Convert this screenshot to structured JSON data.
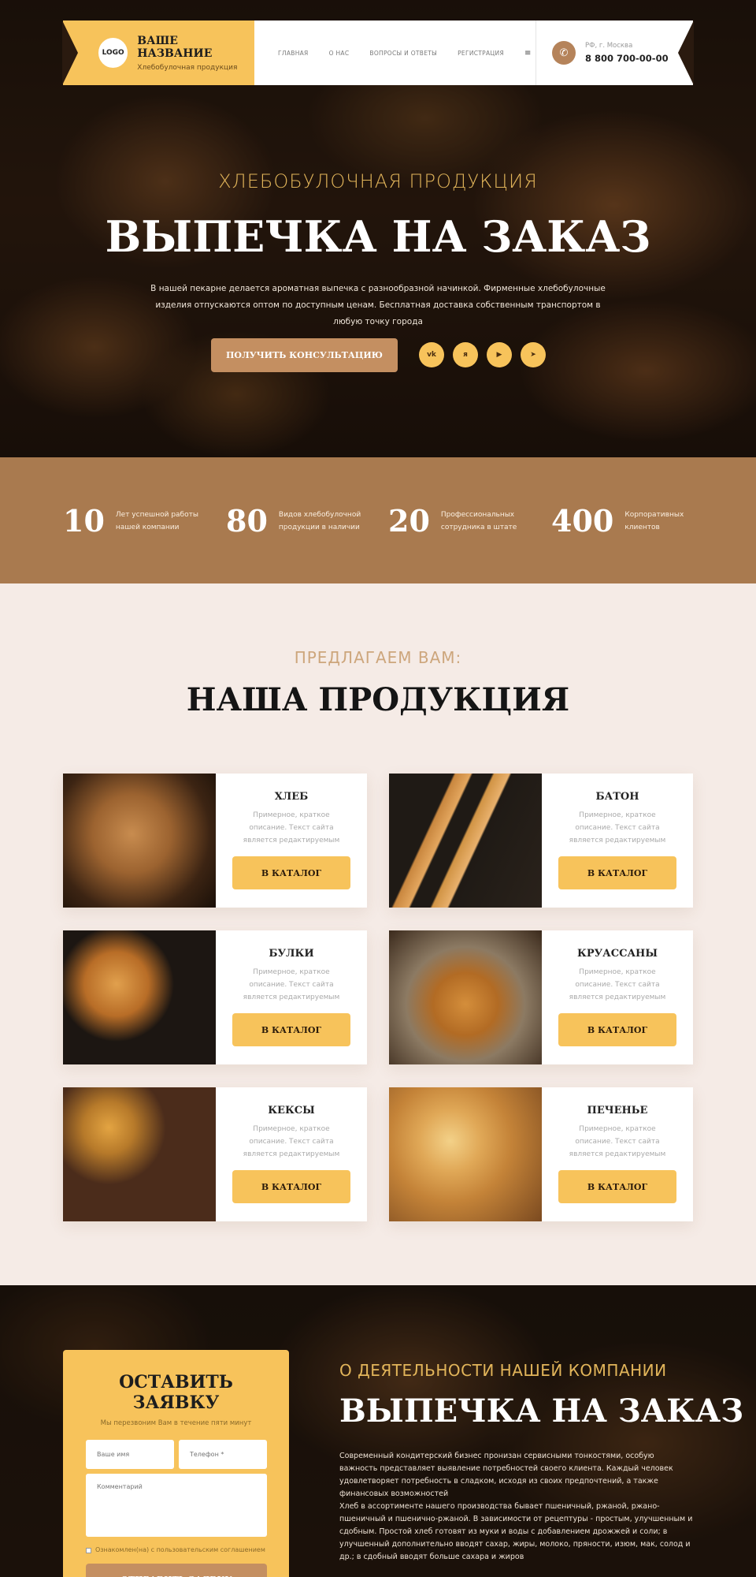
{
  "header": {
    "logo": "LOGO",
    "brand_name": "ВАШЕ НАЗВАНИЕ",
    "brand_sub": "Хлебобулочная продукция",
    "nav": [
      "ГЛАВНАЯ",
      "О НАС",
      "ВОПРОСЫ И ОТВЕТЫ",
      "РЕГИСТРАЦИЯ"
    ],
    "menu_icon": "≡",
    "city": "РФ, г. Москва",
    "phone": "8 800 700-00-00"
  },
  "hero": {
    "kicker": "ХЛЕБОБУЛОЧНАЯ ПРОДУКЦИЯ",
    "title": "ВЫПЕЧКА НА ЗАКАЗ",
    "text": "В нашей пекарне делается ароматная выпечка с разнообразной начинкой. Фирменные хлебобулочные изделия отпускаются оптом по доступным ценам. Бесплатная доставка собственным транспортом в любую точку города",
    "cta": "ПОЛУЧИТЬ КОНСУЛЬТАЦИЮ",
    "socials": [
      {
        "icon": "vk-icon",
        "glyph": "vk"
      },
      {
        "icon": "yandex-icon",
        "glyph": "я"
      },
      {
        "icon": "youtube-icon",
        "glyph": "▶"
      },
      {
        "icon": "telegram-icon",
        "glyph": "➤"
      }
    ]
  },
  "stats": [
    {
      "num": "10",
      "label": "Лет успешной работы нашей компании"
    },
    {
      "num": "80",
      "label": "Видов хлебобулочной продукции в наличии"
    },
    {
      "num": "20",
      "label": "Профессиональных сотрудника в штате"
    },
    {
      "num": "400",
      "label": "Корпоративных клиентов"
    }
  ],
  "products": {
    "kicker": "ПРЕДЛАГАЕМ ВАМ:",
    "title": "НАША ПРОДУКЦИЯ",
    "items": [
      {
        "name": "ХЛЕБ",
        "desc": "Примерное, краткое описание. Текст сайта является редактируемым",
        "btn": "В КАТАЛОГ"
      },
      {
        "name": "БАТОН",
        "desc": "Примерное, краткое описание. Текст сайта является редактируемым",
        "btn": "В КАТАЛОГ"
      },
      {
        "name": "БУЛКИ",
        "desc": "Примерное, краткое описание. Текст сайта является редактируемым",
        "btn": "В КАТАЛОГ"
      },
      {
        "name": "КРУАССАНЫ",
        "desc": "Примерное, краткое описание. Текст сайта является редактируемым",
        "btn": "В КАТАЛОГ"
      },
      {
        "name": "КЕКСЫ",
        "desc": "Примерное, краткое описание. Текст сайта является редактируемым",
        "btn": "В КАТАЛОГ"
      },
      {
        "name": "ПЕЧЕНЬЕ",
        "desc": "Примерное, краткое описание. Текст сайта является редактируемым",
        "btn": "В КАТАЛОГ"
      }
    ]
  },
  "form": {
    "title": "ОСТАВИТЬ ЗАЯВКУ",
    "sub": "Мы перезвоним Вам в течение пяти минут",
    "name_placeholder": "Ваше имя",
    "phone_placeholder": "Телефон *",
    "comment_placeholder": "Комментарий",
    "agree": "Ознакомлен(на) с пользовательским соглашением",
    "submit": "ОТПРАВИТЬ ЗАЯВКУ"
  },
  "about": {
    "kicker": "О ДЕЯТЕЛЬНОСТИ НАШЕЙ КОМПАНИИ",
    "title": "ВЫПЕЧКА НА ЗАКАЗ",
    "p1": "Современный кондитерский бизнес пронизан сервисными тонкостями, особую важность представляет выявление потребностей своего клиента. Каждый человек удовлетворяет потребность в сладком, исходя из своих предпочтений, а также финансовых возможностей",
    "p2": "Хлеб в ассортименте нашего производства бывает пшеничный, ржаной, ржано-пшеничный и пшенично-ржаной. В зависимости от рецептуры - простым, улучшенным и сдобным. Простой хлеб готовят из муки и воды с добавлением дрожжей и соли; в улучшенный дополнительно вводят сахар, жиры, молоко, пряности, изюм, мак, солод и др.; в сдобный вводят больше сахара и жиров"
  },
  "colors": {
    "accent_yellow": "#f7c35b",
    "accent_brown": "#c48f61",
    "stats_bg": "#a97a4f",
    "page_bg": "#f5ebe6"
  }
}
